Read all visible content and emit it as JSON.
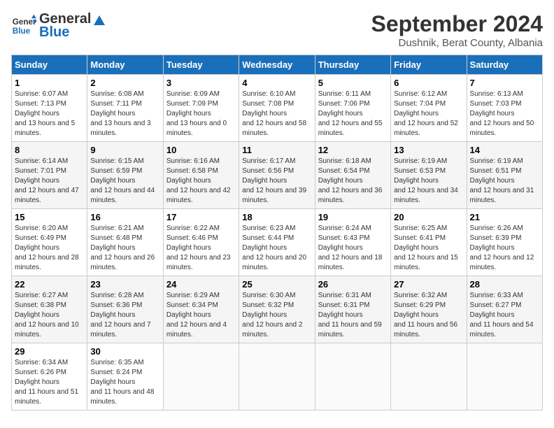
{
  "header": {
    "logo_line1": "General",
    "logo_line2": "Blue",
    "month_title": "September 2024",
    "location": "Dushnik, Berat County, Albania"
  },
  "weekdays": [
    "Sunday",
    "Monday",
    "Tuesday",
    "Wednesday",
    "Thursday",
    "Friday",
    "Saturday"
  ],
  "weeks": [
    [
      {
        "day": "1",
        "sunrise": "6:07 AM",
        "sunset": "7:13 PM",
        "daylight": "13 hours and 5 minutes."
      },
      {
        "day": "2",
        "sunrise": "6:08 AM",
        "sunset": "7:11 PM",
        "daylight": "13 hours and 3 minutes."
      },
      {
        "day": "3",
        "sunrise": "6:09 AM",
        "sunset": "7:09 PM",
        "daylight": "13 hours and 0 minutes."
      },
      {
        "day": "4",
        "sunrise": "6:10 AM",
        "sunset": "7:08 PM",
        "daylight": "12 hours and 58 minutes."
      },
      {
        "day": "5",
        "sunrise": "6:11 AM",
        "sunset": "7:06 PM",
        "daylight": "12 hours and 55 minutes."
      },
      {
        "day": "6",
        "sunrise": "6:12 AM",
        "sunset": "7:04 PM",
        "daylight": "12 hours and 52 minutes."
      },
      {
        "day": "7",
        "sunrise": "6:13 AM",
        "sunset": "7:03 PM",
        "daylight": "12 hours and 50 minutes."
      }
    ],
    [
      {
        "day": "8",
        "sunrise": "6:14 AM",
        "sunset": "7:01 PM",
        "daylight": "12 hours and 47 minutes."
      },
      {
        "day": "9",
        "sunrise": "6:15 AM",
        "sunset": "6:59 PM",
        "daylight": "12 hours and 44 minutes."
      },
      {
        "day": "10",
        "sunrise": "6:16 AM",
        "sunset": "6:58 PM",
        "daylight": "12 hours and 42 minutes."
      },
      {
        "day": "11",
        "sunrise": "6:17 AM",
        "sunset": "6:56 PM",
        "daylight": "12 hours and 39 minutes."
      },
      {
        "day": "12",
        "sunrise": "6:18 AM",
        "sunset": "6:54 PM",
        "daylight": "12 hours and 36 minutes."
      },
      {
        "day": "13",
        "sunrise": "6:19 AM",
        "sunset": "6:53 PM",
        "daylight": "12 hours and 34 minutes."
      },
      {
        "day": "14",
        "sunrise": "6:19 AM",
        "sunset": "6:51 PM",
        "daylight": "12 hours and 31 minutes."
      }
    ],
    [
      {
        "day": "15",
        "sunrise": "6:20 AM",
        "sunset": "6:49 PM",
        "daylight": "12 hours and 28 minutes."
      },
      {
        "day": "16",
        "sunrise": "6:21 AM",
        "sunset": "6:48 PM",
        "daylight": "12 hours and 26 minutes."
      },
      {
        "day": "17",
        "sunrise": "6:22 AM",
        "sunset": "6:46 PM",
        "daylight": "12 hours and 23 minutes."
      },
      {
        "day": "18",
        "sunrise": "6:23 AM",
        "sunset": "6:44 PM",
        "daylight": "12 hours and 20 minutes."
      },
      {
        "day": "19",
        "sunrise": "6:24 AM",
        "sunset": "6:43 PM",
        "daylight": "12 hours and 18 minutes."
      },
      {
        "day": "20",
        "sunrise": "6:25 AM",
        "sunset": "6:41 PM",
        "daylight": "12 hours and 15 minutes."
      },
      {
        "day": "21",
        "sunrise": "6:26 AM",
        "sunset": "6:39 PM",
        "daylight": "12 hours and 12 minutes."
      }
    ],
    [
      {
        "day": "22",
        "sunrise": "6:27 AM",
        "sunset": "6:38 PM",
        "daylight": "12 hours and 10 minutes."
      },
      {
        "day": "23",
        "sunrise": "6:28 AM",
        "sunset": "6:36 PM",
        "daylight": "12 hours and 7 minutes."
      },
      {
        "day": "24",
        "sunrise": "6:29 AM",
        "sunset": "6:34 PM",
        "daylight": "12 hours and 4 minutes."
      },
      {
        "day": "25",
        "sunrise": "6:30 AM",
        "sunset": "6:32 PM",
        "daylight": "12 hours and 2 minutes."
      },
      {
        "day": "26",
        "sunrise": "6:31 AM",
        "sunset": "6:31 PM",
        "daylight": "11 hours and 59 minutes."
      },
      {
        "day": "27",
        "sunrise": "6:32 AM",
        "sunset": "6:29 PM",
        "daylight": "11 hours and 56 minutes."
      },
      {
        "day": "28",
        "sunrise": "6:33 AM",
        "sunset": "6:27 PM",
        "daylight": "11 hours and 54 minutes."
      }
    ],
    [
      {
        "day": "29",
        "sunrise": "6:34 AM",
        "sunset": "6:26 PM",
        "daylight": "11 hours and 51 minutes."
      },
      {
        "day": "30",
        "sunrise": "6:35 AM",
        "sunset": "6:24 PM",
        "daylight": "11 hours and 48 minutes."
      },
      null,
      null,
      null,
      null,
      null
    ]
  ]
}
